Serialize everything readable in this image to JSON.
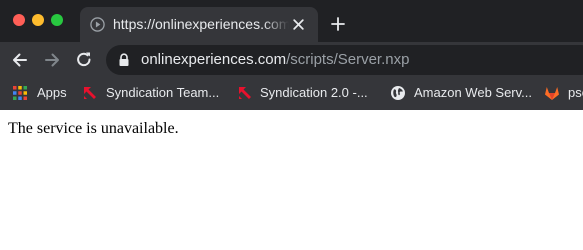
{
  "browser": {
    "tab": {
      "title": "https://onlinexperiences.com/scripts/Server.nxp",
      "favicon": "play-circle-icon"
    },
    "toolbar": {
      "url_host": "onlinexperiences.com",
      "url_path": "/scripts/Server.nxp"
    },
    "bookmarks": [
      {
        "label": "Apps",
        "icon": "apps-grid-icon"
      },
      {
        "label": "Syndication Team...",
        "icon": "syndication-icon"
      },
      {
        "label": "Syndication 2.0 -...",
        "icon": "syndication-icon"
      },
      {
        "label": "Amazon Web Serv...",
        "icon": "globe-icon"
      },
      {
        "label": "pse",
        "icon": "gitlab-icon"
      }
    ]
  },
  "page": {
    "message": "The service is unavailable."
  },
  "colors": {
    "chrome_dark": "#202124",
    "toolbar": "#35363a",
    "text_light": "#e8eaed",
    "text_dim": "#9aa0a6",
    "syndication_red": "#e8112d",
    "gitlab_orange": "#fc6d26"
  }
}
